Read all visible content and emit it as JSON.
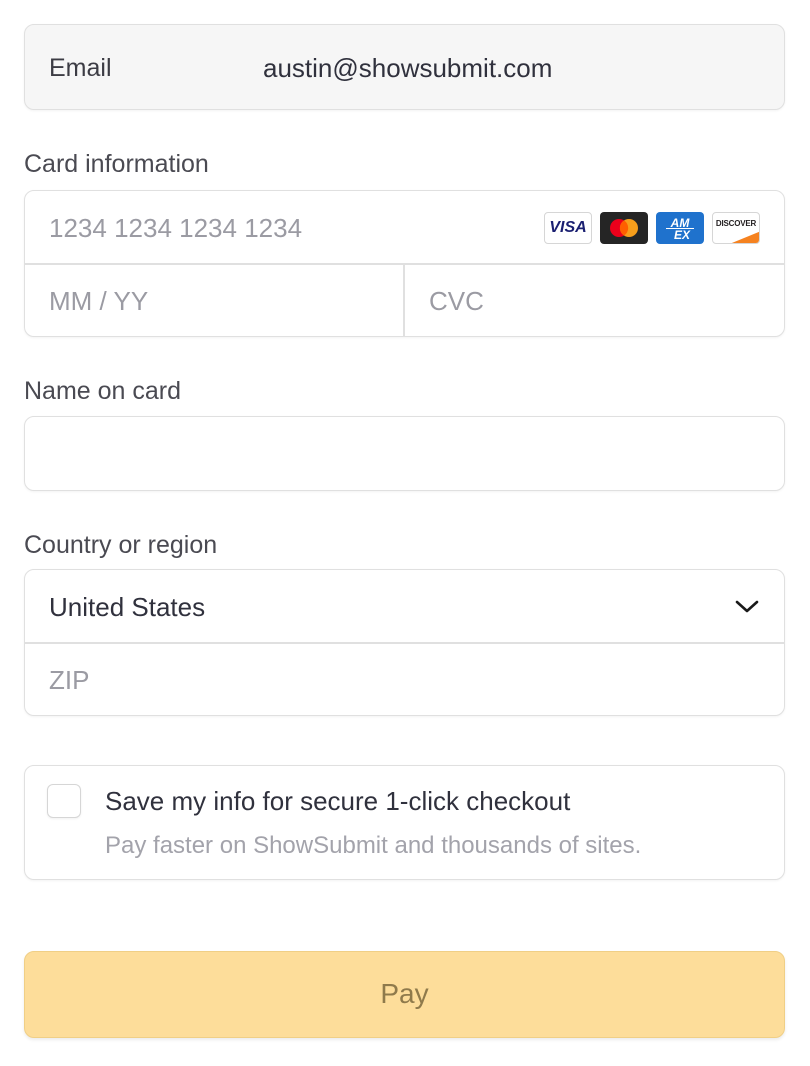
{
  "email": {
    "label": "Email",
    "value": "austin@showsubmit.com"
  },
  "card": {
    "label": "Card information",
    "number_placeholder": "1234 1234 1234 1234",
    "expiry_placeholder": "MM / YY",
    "cvc_placeholder": "CVC",
    "brands": [
      {
        "name": "VISA",
        "icon": "visa-logo"
      },
      {
        "name": "Mastercard",
        "icon": "mastercard-logo"
      },
      {
        "name": "AMEX",
        "icon": "amex-logo"
      },
      {
        "name": "DISCOVER",
        "icon": "discover-logo"
      }
    ]
  },
  "name_on_card": {
    "label": "Name on card",
    "value": ""
  },
  "country": {
    "label": "Country or region",
    "selected": "United States",
    "zip_placeholder": "ZIP"
  },
  "save_info": {
    "title": "Save my info for secure 1-click checkout",
    "subtitle": "Pay faster on ShowSubmit and thousands of sites.",
    "checked": false
  },
  "pay": {
    "label": "Pay"
  },
  "colors": {
    "pay_button_bg": "#fddd9a",
    "pay_button_text": "#8f7a4b",
    "border": "#e0e0e0",
    "placeholder": "#9b9ba3"
  }
}
